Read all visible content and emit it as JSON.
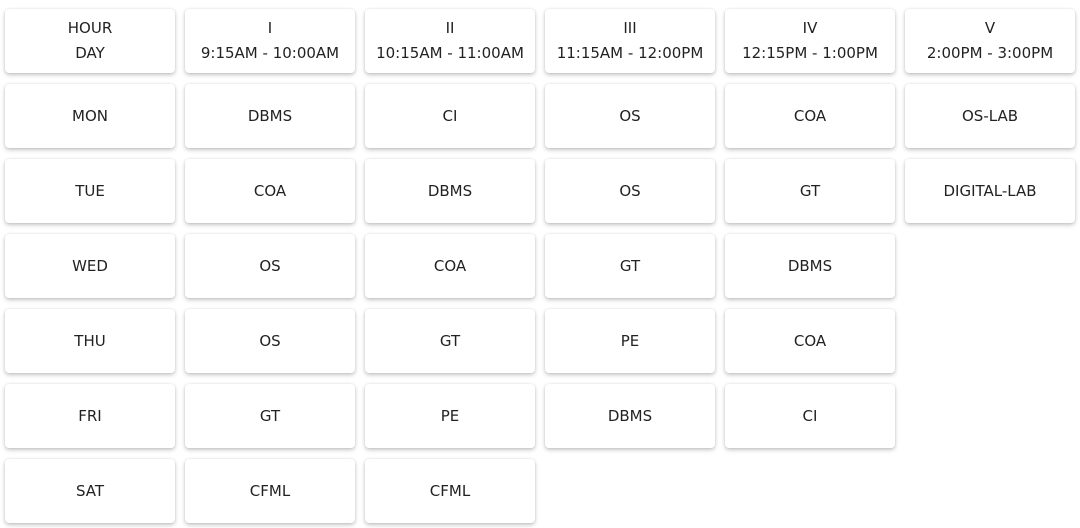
{
  "header": {
    "corner": {
      "line1": "HOUR",
      "line2": "DAY"
    },
    "periods": [
      {
        "numeral": "I",
        "time": "9:15AM - 10:00AM"
      },
      {
        "numeral": "II",
        "time": "10:15AM - 11:00AM"
      },
      {
        "numeral": "III",
        "time": "11:15AM - 12:00PM"
      },
      {
        "numeral": "IV",
        "time": "12:15PM - 1:00PM"
      },
      {
        "numeral": "V",
        "time": "2:00PM - 3:00PM"
      }
    ]
  },
  "rows": [
    {
      "day": "MON",
      "subjects": [
        "DBMS",
        "CI",
        "OS",
        "COA",
        "OS-LAB"
      ]
    },
    {
      "day": "TUE",
      "subjects": [
        "COA",
        "DBMS",
        "OS",
        "GT",
        "DIGITAL-LAB"
      ]
    },
    {
      "day": "WED",
      "subjects": [
        "OS",
        "COA",
        "GT",
        "DBMS"
      ]
    },
    {
      "day": "THU",
      "subjects": [
        "OS",
        "GT",
        "PE",
        "COA"
      ]
    },
    {
      "day": "FRI",
      "subjects": [
        "GT",
        "PE",
        "DBMS",
        "CI"
      ]
    },
    {
      "day": "SAT",
      "subjects": [
        "CFML",
        "CFML"
      ]
    }
  ]
}
